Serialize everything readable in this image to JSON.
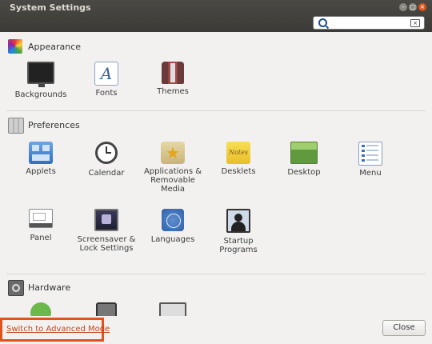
{
  "window": {
    "title": "System Settings",
    "controls": {
      "minimize": "–",
      "maximize": "□",
      "close": "×"
    }
  },
  "search": {
    "value": "",
    "placeholder": ""
  },
  "sections": {
    "appearance": {
      "title": "Appearance",
      "icon": "appearance-icon"
    },
    "preferences": {
      "title": "Preferences",
      "icon": "preferences-icon"
    },
    "hardware": {
      "title": "Hardware",
      "icon": "hardware-icon"
    }
  },
  "appearance_items": {
    "backgrounds": "Backgrounds",
    "fonts": "Fonts",
    "fonts_glyph": "A",
    "themes": "Themes"
  },
  "preferences_items": {
    "applets": "Applets",
    "calendar": "Calendar",
    "applications_line1": "Applications &",
    "applications_line2": "Removable",
    "applications_line3": "Media",
    "desklets": "Desklets",
    "desklets_glyph": "Notes",
    "desktop": "Desktop",
    "menu": "Menu",
    "panel": "Panel",
    "screensaver_line1": "Screensaver &",
    "screensaver_line2": "Lock Settings",
    "languages": "Languages",
    "startup_line1": "Startup",
    "startup_line2": "Programs"
  },
  "bottom": {
    "advanced_link": "Switch to Advanced Mode",
    "close_button": "Close"
  },
  "colors": {
    "accent": "#e0531b",
    "titlebar": "#3c3b37",
    "background": "#f2f1f0"
  }
}
